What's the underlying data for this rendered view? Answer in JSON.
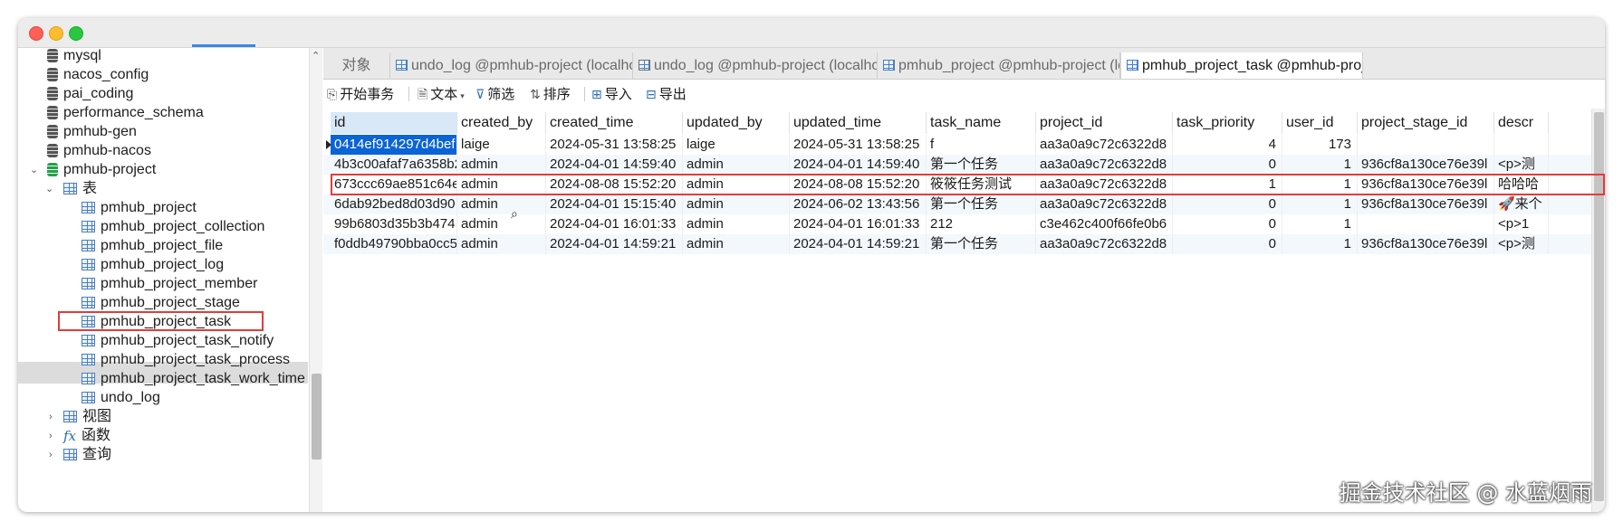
{
  "sidebar": {
    "items": [
      {
        "label": "mysql",
        "kind": "db"
      },
      {
        "label": "nacos_config",
        "kind": "db"
      },
      {
        "label": "pai_coding",
        "kind": "db"
      },
      {
        "label": "performance_schema",
        "kind": "db"
      },
      {
        "label": "pmhub-gen",
        "kind": "db"
      },
      {
        "label": "pmhub-nacos",
        "kind": "db"
      },
      {
        "label": "pmhub-project",
        "kind": "db-open"
      },
      {
        "label": "表",
        "kind": "folder-tables"
      },
      {
        "label": "pmhub_project",
        "kind": "table"
      },
      {
        "label": "pmhub_project_collection",
        "kind": "table"
      },
      {
        "label": "pmhub_project_file",
        "kind": "table"
      },
      {
        "label": "pmhub_project_log",
        "kind": "table"
      },
      {
        "label": "pmhub_project_member",
        "kind": "table"
      },
      {
        "label": "pmhub_project_stage",
        "kind": "table"
      },
      {
        "label": "pmhub_project_task",
        "kind": "table",
        "selected": true
      },
      {
        "label": "pmhub_project_task_notify",
        "kind": "table"
      },
      {
        "label": "pmhub_project_task_process",
        "kind": "table"
      },
      {
        "label": "pmhub_project_task_work_time",
        "kind": "table"
      },
      {
        "label": "undo_log",
        "kind": "table"
      },
      {
        "label": "视图",
        "kind": "folder-views"
      },
      {
        "label": "函数",
        "kind": "folder-functions"
      },
      {
        "label": "查询",
        "kind": "folder-queries"
      }
    ]
  },
  "tabs": [
    {
      "label": "对象",
      "icon": "none"
    },
    {
      "label": "undo_log @pmhub-project (localho...",
      "icon": "table-icon"
    },
    {
      "label": "undo_log @pmhub-project (localho...",
      "icon": "design-table-icon"
    },
    {
      "label": "pmhub_project @pmhub-project (lo...",
      "icon": "table-icon"
    },
    {
      "label": "pmhub_project_task @pmhub-proje...",
      "icon": "table-icon",
      "active": true
    }
  ],
  "toolbar": {
    "begin_tx": "开始事务",
    "text": "文本",
    "filter": "筛选",
    "sort": "排序",
    "import": "导入",
    "export": "导出"
  },
  "grid": {
    "columns": [
      "id",
      "created_by",
      "created_time",
      "updated_by",
      "updated_time",
      "task_name",
      "project_id",
      "task_priority",
      "user_id",
      "project_stage_id",
      "descr"
    ],
    "rows": [
      [
        "0414ef914297d4bef",
        "laige",
        "2024-05-31 13:58:25",
        "laige",
        "2024-05-31 13:58:25",
        "f",
        "aa3a0a9c72c6322d8",
        "4",
        "173",
        "",
        ""
      ],
      [
        "4b3c00afaf7a6358b2",
        "admin",
        "2024-04-01 14:59:40",
        "admin",
        "2024-04-01 14:59:40",
        "第一个任务",
        "aa3a0a9c72c6322d8",
        "0",
        "1",
        "936cf8a130ce76e39l",
        "<p>测"
      ],
      [
        "673ccc69ae851c64e",
        "admin",
        "2024-08-08 15:52:20",
        "admin",
        "2024-08-08 15:52:20",
        "筱筱任务测试",
        "aa3a0a9c72c6322d8",
        "1",
        "1",
        "936cf8a130ce76e39l",
        "哈哈哈"
      ],
      [
        "6dab92bed8d03d90",
        "admin",
        "2024-04-01 15:15:40",
        "admin",
        "2024-06-02 13:43:56",
        "第一个任务",
        "aa3a0a9c72c6322d8",
        "0",
        "1",
        "936cf8a130ce76e39l",
        "🚀来个"
      ],
      [
        "99b6803d35b3b474",
        "admin",
        "2024-04-01 16:01:33",
        "admin",
        "2024-04-01 16:01:33",
        "212",
        "c3e462c400f66fe0b6",
        "0",
        "1",
        "",
        "<p>1"
      ],
      [
        "f0ddb49790bba0cc5",
        "admin",
        "2024-04-01 14:59:21",
        "admin",
        "2024-04-01 14:59:21",
        "第一个任务",
        "aa3a0a9c72c6322d8",
        "0",
        "1",
        "936cf8a130ce76e39l",
        "<p>测"
      ]
    ]
  },
  "watermark": "掘金技术社区 @ 水蓝烟雨",
  "colors": {
    "highlight_border": "#e33b3b",
    "selection": "#0a64d6"
  }
}
